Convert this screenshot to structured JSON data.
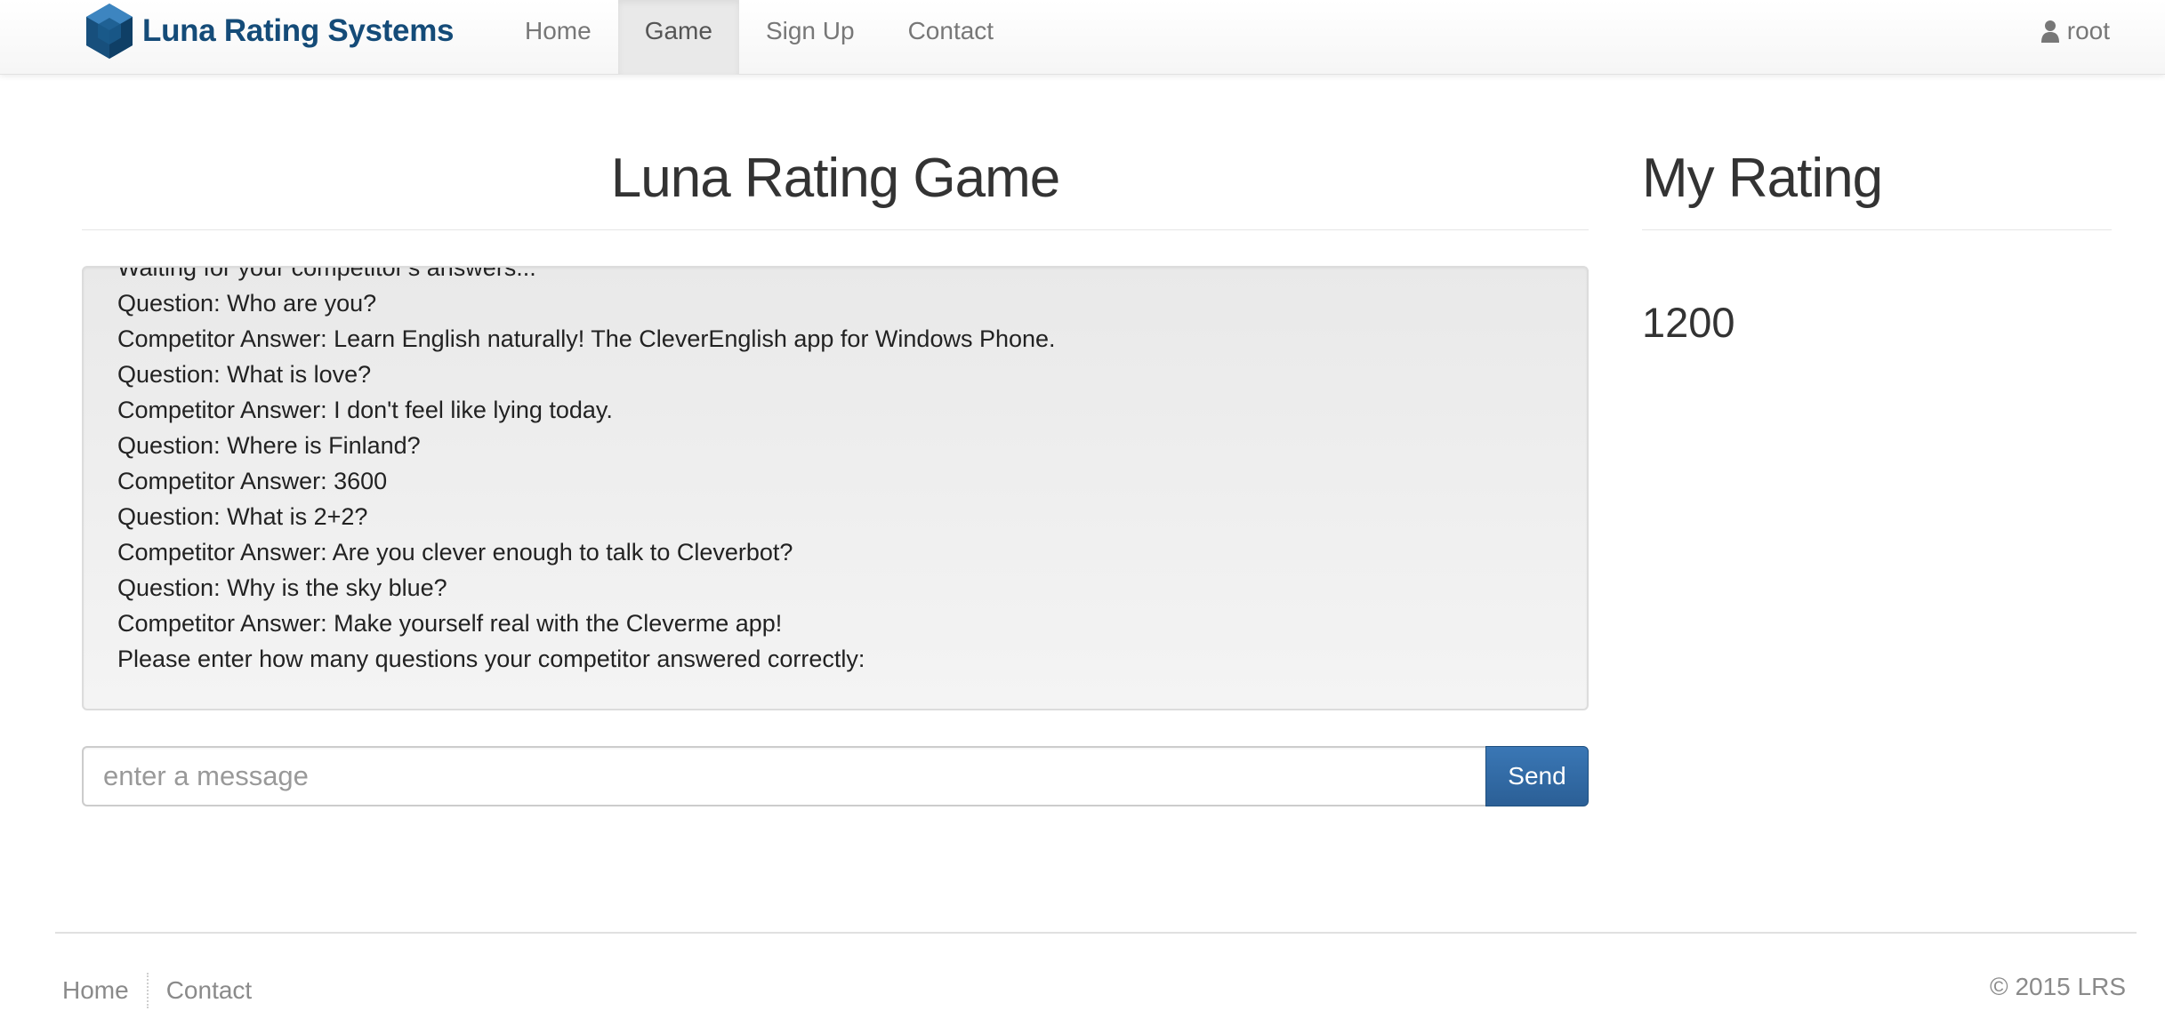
{
  "navbar": {
    "brand_name": "Luna Rating Systems",
    "brand_color": "#144b78",
    "logo_icon": "hexagon-cube-logo",
    "links": [
      {
        "label": "Home",
        "active": false
      },
      {
        "label": "Game",
        "active": true
      },
      {
        "label": "Sign Up",
        "active": false
      },
      {
        "label": "Contact",
        "active": false
      }
    ],
    "user": {
      "icon": "user-icon",
      "name": "root"
    }
  },
  "main": {
    "title": "Luna Rating Game",
    "chat_lines": [
      "Waiting for your competitor's answers...",
      "Question: Who are you?",
      "Competitor Answer: Learn English naturally! The CleverEnglish app for Windows Phone.",
      "Question: What is love?",
      "Competitor Answer: I don't feel like lying today.",
      "Question: Where is Finland?",
      "Competitor Answer: 3600",
      "Question: What is 2+2?",
      "Competitor Answer: Are you clever enough to talk to Cleverbot?",
      "Question: Why is the sky blue?",
      "Competitor Answer: Make yourself real with the Cleverme app!",
      "Please enter how many questions your competitor answered correctly:"
    ],
    "input": {
      "placeholder": "enter a message",
      "value": ""
    },
    "send_label": "Send",
    "send_color": "#2f6aa6"
  },
  "sidebar": {
    "title": "My Rating",
    "rating": "1200"
  },
  "footer": {
    "links": [
      "Home",
      "Contact"
    ],
    "copyright": "© 2015 LRS"
  }
}
